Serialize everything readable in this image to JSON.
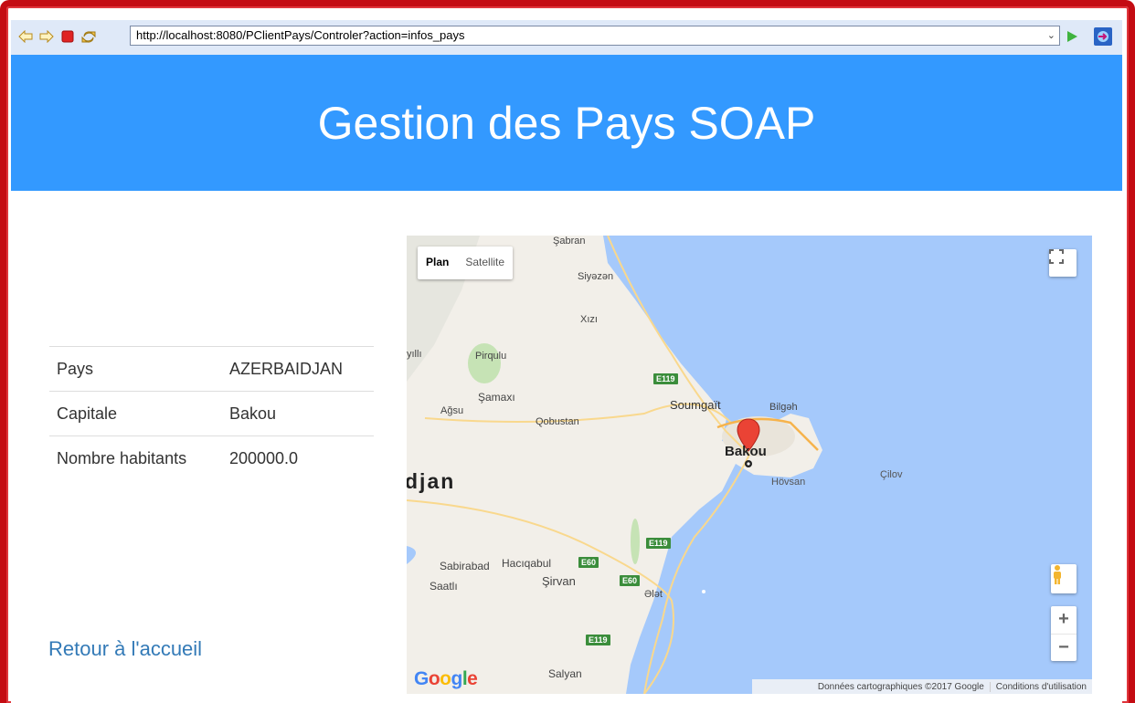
{
  "browser": {
    "url": "http://localhost:8080/PClientPays/Controler?action=infos_pays"
  },
  "header": {
    "title": "Gestion des Pays SOAP"
  },
  "info": {
    "rows": [
      {
        "label": "Pays",
        "value": "AZERBAIDJAN"
      },
      {
        "label": "Capitale",
        "value": "Bakou"
      },
      {
        "label": "Nombre habitants",
        "value": "200000.0"
      }
    ]
  },
  "home_link": "Retour à l'accueil",
  "map": {
    "type_plan": "Plan",
    "type_satellite": "Satellite",
    "labels": {
      "sabran": "Şabran",
      "siyazan": "Siyəzən",
      "xizi": "Xızı",
      "pirqulu": "Pirqulu",
      "yilli": "yıllı",
      "samaxi": "Şamaxı",
      "agsu": "Ağsu",
      "qobustan": "Qobustan",
      "soumgait": "Soumgaït",
      "bilgah": "Bilgəh",
      "bakou": "Bakou",
      "hovsan": "Hövsan",
      "cilov": "Çilov",
      "djan": "djan",
      "sabirabad": "Sabirabad",
      "haciqabul": "Hacıqabul",
      "saatli": "Saatlı",
      "sirvan": "Şirvan",
      "alat": "Ələt",
      "salyan": "Salyan"
    },
    "roads": {
      "e119_a": "E119",
      "e119_b": "E119",
      "e119_c": "E119",
      "e60_a": "E60",
      "e60_b": "E60"
    },
    "zoom_in": "+",
    "zoom_out": "−",
    "google": "Google",
    "attribution": "Données cartographiques ©2017 Google",
    "terms": "Conditions d'utilisation"
  }
}
